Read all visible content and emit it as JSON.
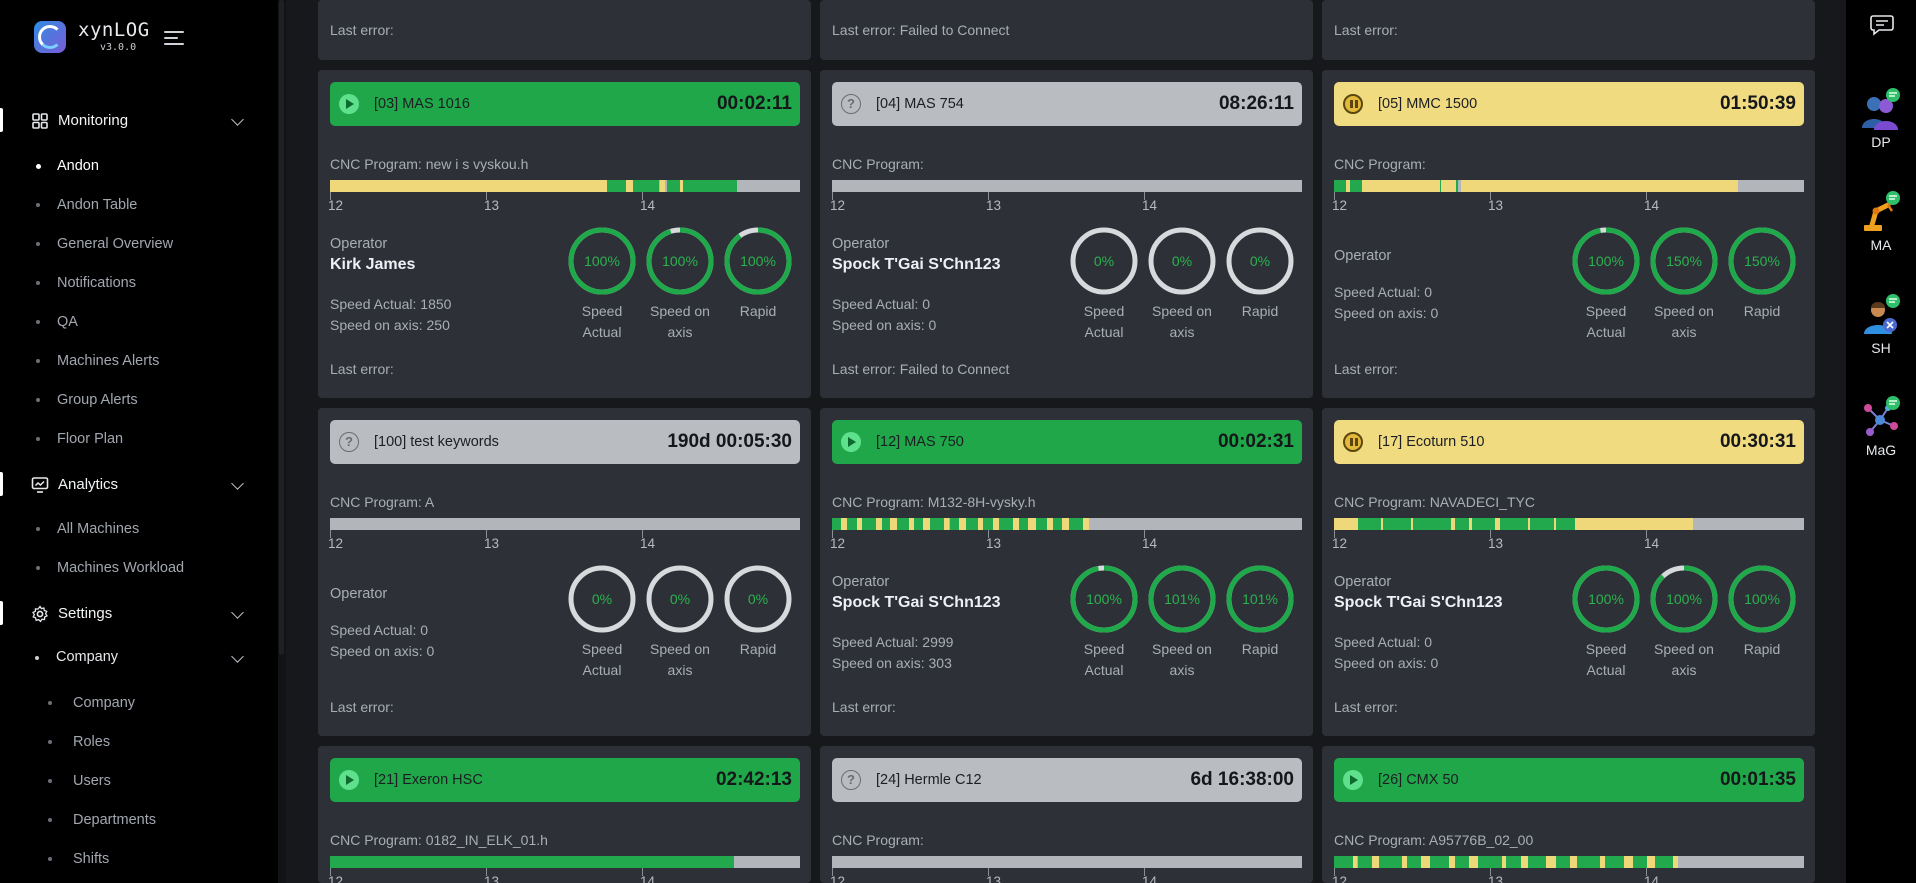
{
  "app": {
    "name": "xynLOG",
    "version": "v3.0.0"
  },
  "nav": {
    "monitoring": {
      "label": "Monitoring",
      "items": [
        "Andon",
        "Andon Table",
        "General Overview",
        "Notifications",
        "QA",
        "Machines Alerts",
        "Group Alerts",
        "Floor Plan"
      ]
    },
    "analytics": {
      "label": "Analytics",
      "items": [
        "All Machines",
        "Machines Workload"
      ]
    },
    "settings": {
      "label": "Settings",
      "group": "Company",
      "items": [
        "Company",
        "Roles",
        "Users",
        "Departments",
        "Shifts"
      ]
    }
  },
  "labels": {
    "cnc_program": "CNC Program:",
    "operator": "Operator",
    "speed_actual": "Speed Actual:",
    "speed_on_axis": "Speed on axis:",
    "last_error": "Last error:",
    "gauge_speed_actual": [
      "Speed",
      "Actual"
    ],
    "gauge_speed_on_axis": [
      "Speed on",
      "axis"
    ],
    "gauge_rapid": "Rapid",
    "timeline_ticks": [
      "12",
      "13",
      "14"
    ]
  },
  "top_errors": [
    "Last error:",
    "Last error: Failed to Connect",
    "Last error:"
  ],
  "cards": [
    {
      "status": "running",
      "color": "#1fa74a",
      "name": "[03] MAS 1016",
      "time": "00:02:11",
      "program": "new i s vyskou.h",
      "operator": "Kirk James",
      "speed_actual": "1850",
      "speed_axis": "250",
      "gauges": [
        {
          "value": "100%",
          "fill": 1.0
        },
        {
          "value": "100%",
          "fill": 0.95
        },
        {
          "value": "100%",
          "fill": 0.9
        }
      ],
      "last_error": "",
      "timeline": "y0-0.59,g0.59-0.86"
    },
    {
      "status": "unknown",
      "color": "#b9bcc1",
      "name": "[04] MAS 754",
      "time": "08:26:11",
      "program": "",
      "operator": "Spock T'Gai S'Chn123",
      "speed_actual": "0",
      "speed_axis": "0",
      "gauges": [
        {
          "value": "0%",
          "fill": 0
        },
        {
          "value": "0%",
          "fill": 0
        },
        {
          "value": "0%",
          "fill": 0
        }
      ],
      "last_error": "Failed to Connect",
      "timeline": "none"
    },
    {
      "status": "paused",
      "color": "#f0db81",
      "name": "[05] MMC 1500",
      "time": "01:50:39",
      "program": "",
      "operator": "",
      "speed_actual": "0",
      "speed_axis": "0",
      "gauges": [
        {
          "value": "100%",
          "fill": 0.97
        },
        {
          "value": "150%",
          "fill": 1.0
        },
        {
          "value": "150%",
          "fill": 1.0
        }
      ],
      "last_error": "",
      "timeline": "mixed-a"
    },
    {
      "status": "unknown",
      "color": "#b9bcc1",
      "name": "[100] test keywords",
      "time": "190d 00:05:30",
      "program": "A",
      "operator": "",
      "speed_actual": "0",
      "speed_axis": "0",
      "gauges": [
        {
          "value": "0%",
          "fill": 0
        },
        {
          "value": "0%",
          "fill": 0
        },
        {
          "value": "0%",
          "fill": 0
        }
      ],
      "last_error": "",
      "timeline": "none"
    },
    {
      "status": "running",
      "color": "#1fa74a",
      "name": "[12] MAS 750",
      "time": "00:02:31",
      "program": "M132-8H-vysky.h",
      "operator": "Spock T'Gai S'Chn123",
      "speed_actual": "2999",
      "speed_axis": "303",
      "gauges": [
        {
          "value": "100%",
          "fill": 0.97
        },
        {
          "value": "101%",
          "fill": 1.0
        },
        {
          "value": "101%",
          "fill": 1.0
        }
      ],
      "last_error": "",
      "timeline": "mixed-b"
    },
    {
      "status": "paused",
      "color": "#f0db81",
      "name": "[17] Ecoturn 510",
      "time": "00:30:31",
      "program": "NAVADECI_TYC",
      "operator": "Spock T'Gai S'Chn123",
      "speed_actual": "0",
      "speed_axis": "0",
      "gauges": [
        {
          "value": "100%",
          "fill": 1.0
        },
        {
          "value": "100%",
          "fill": 0.88
        },
        {
          "value": "100%",
          "fill": 1.0
        }
      ],
      "last_error": "",
      "timeline": "mixed-c"
    },
    {
      "status": "running",
      "color": "#1fa74a",
      "name": "[21] Exeron HSC",
      "time": "02:42:13",
      "program": "0182_IN_ELK_01.h",
      "operator": "",
      "speed_actual": "",
      "speed_axis": "",
      "gauges": [],
      "last_error": "",
      "timeline": "g0-0.86"
    },
    {
      "status": "unknown",
      "color": "#b9bcc1",
      "name": "[24] Hermle C12",
      "time": "6d 16:38:00",
      "program": "",
      "operator": "",
      "speed_actual": "",
      "speed_axis": "",
      "gauges": [],
      "last_error": "",
      "timeline": "none"
    },
    {
      "status": "running",
      "color": "#1fa74a",
      "name": "[26] CMX 50",
      "time": "00:01:35",
      "program": "A95776B_02_00",
      "operator": "",
      "speed_actual": "",
      "speed_axis": "",
      "gauges": [],
      "last_error": "",
      "timeline": "mixed-d"
    }
  ],
  "users": [
    {
      "initials": "DP",
      "icon": "people-avatar-icon"
    },
    {
      "initials": "MA",
      "icon": "robot-arm-avatar-icon"
    },
    {
      "initials": "SH",
      "icon": "person-avatar-icon"
    },
    {
      "initials": "MaG",
      "icon": "network-avatar-icon"
    }
  ]
}
